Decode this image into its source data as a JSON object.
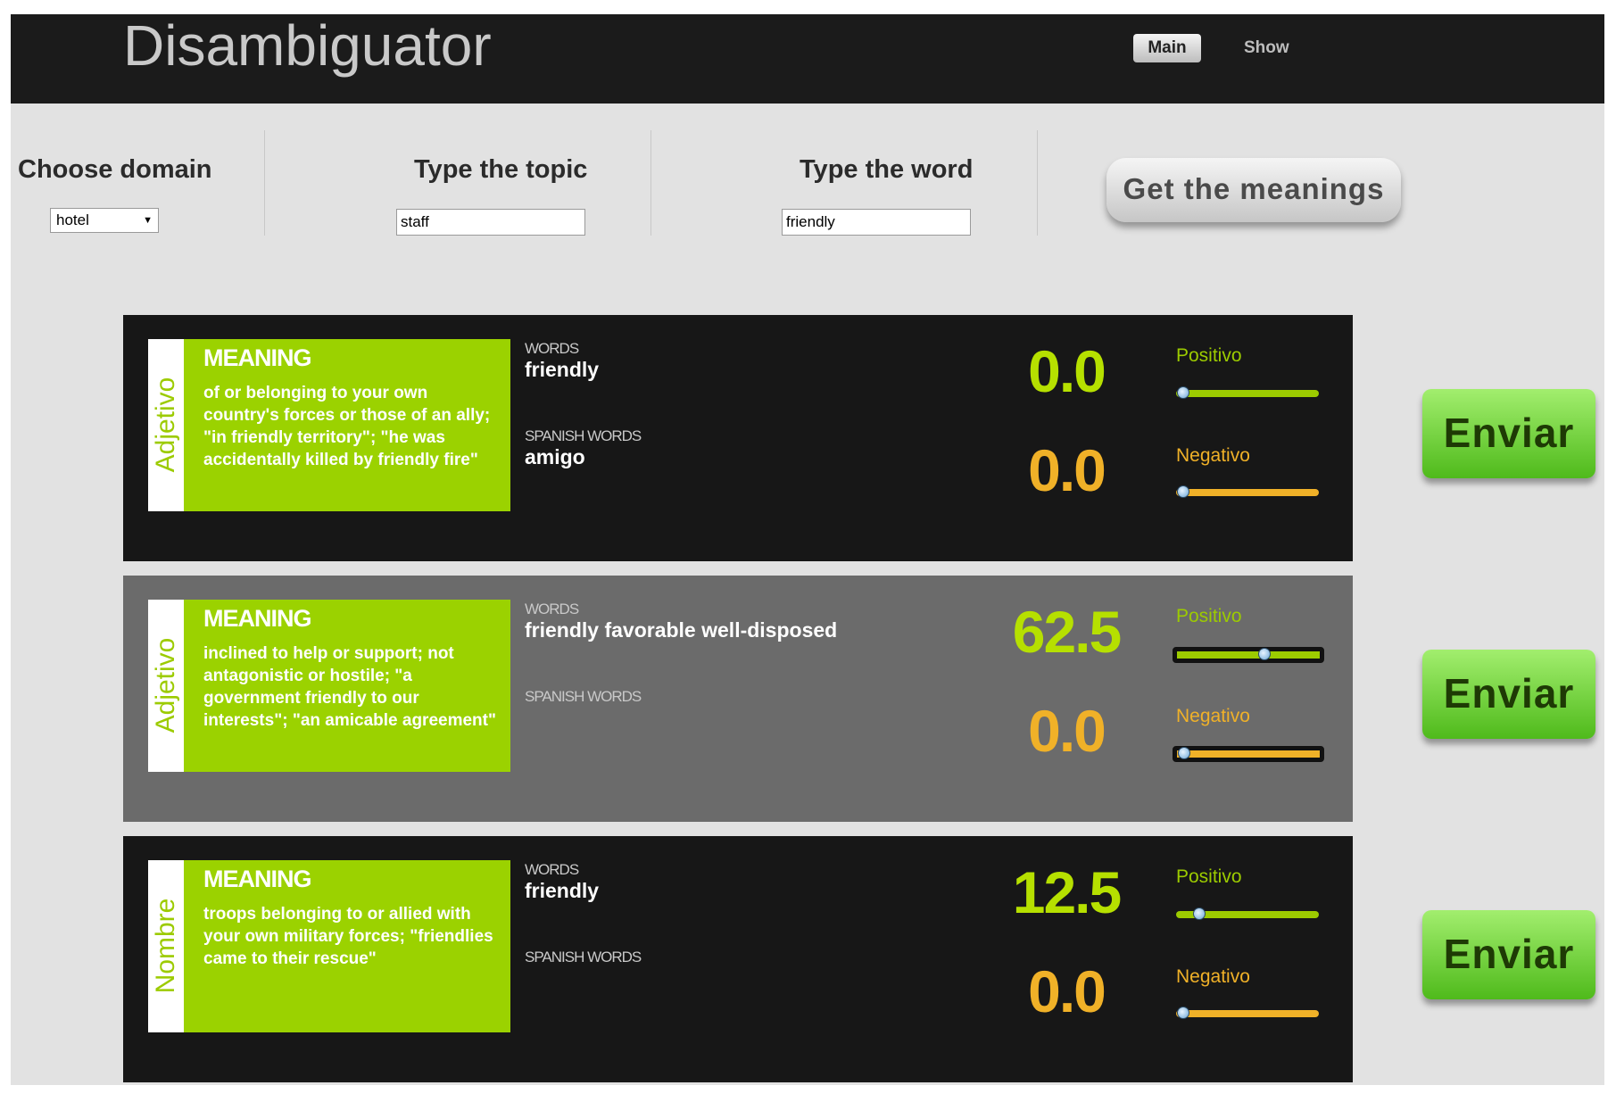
{
  "header": {
    "title": "Disambiguator",
    "nav": [
      {
        "label": "Main",
        "active": true
      },
      {
        "label": "Show",
        "active": false
      }
    ]
  },
  "controls": {
    "domain_label": "Choose domain",
    "domain_value": "hotel",
    "topic_label": "Type the topic",
    "topic_value": "staff",
    "word_label": "Type the word",
    "word_value": "friendly",
    "get_button": "Get the meanings"
  },
  "meanings": [
    {
      "pos": "Adjetivo",
      "heading": "MEANING",
      "definition": "of or belonging to your own country's forces or those of an ally; \"in friendly territory\"; \"he was accidentally killed by friendly fire\"",
      "words_label": "WORDS",
      "words": "friendly",
      "spanish_label": "SPANISH WORDS",
      "spanish": "amigo",
      "positive_score": "0.0",
      "negative_score": "0.0",
      "positive_label": "Positivo",
      "negative_label": "Negativo",
      "positive_level": 0.0,
      "negative_level": 0.0,
      "send": "Enviar"
    },
    {
      "pos": "Adjetivo",
      "heading": "MEANING",
      "definition": "inclined to help or support; not antagonistic or hostile; \"a government friendly to our interests\"; \"an amicable agreement\"",
      "words_label": "WORDS",
      "words": "friendly favorable well-disposed",
      "spanish_label": "SPANISH WORDS",
      "spanish": "",
      "positive_score": "62.5",
      "negative_score": "0.0",
      "positive_label": "Positivo",
      "negative_label": "Negativo",
      "positive_level": 0.625,
      "negative_level": 0.0,
      "send": "Enviar"
    },
    {
      "pos": "Nombre",
      "heading": "MEANING",
      "definition": "troops belonging to or allied with your own military forces; \"friendlies came to their rescue\"",
      "words_label": "WORDS",
      "words": "friendly",
      "spanish_label": "SPANISH WORDS",
      "spanish": "",
      "positive_score": "12.5",
      "negative_score": "0.0",
      "positive_label": "Positivo",
      "negative_label": "Negativo",
      "positive_level": 0.125,
      "negative_level": 0.0,
      "send": "Enviar"
    }
  ],
  "colors": {
    "header_bg": "#1b1b1b",
    "meaning_green": "#9bd200",
    "positive": "#b6e000",
    "negative": "#f0b128",
    "send_button": "#6fd23a"
  }
}
